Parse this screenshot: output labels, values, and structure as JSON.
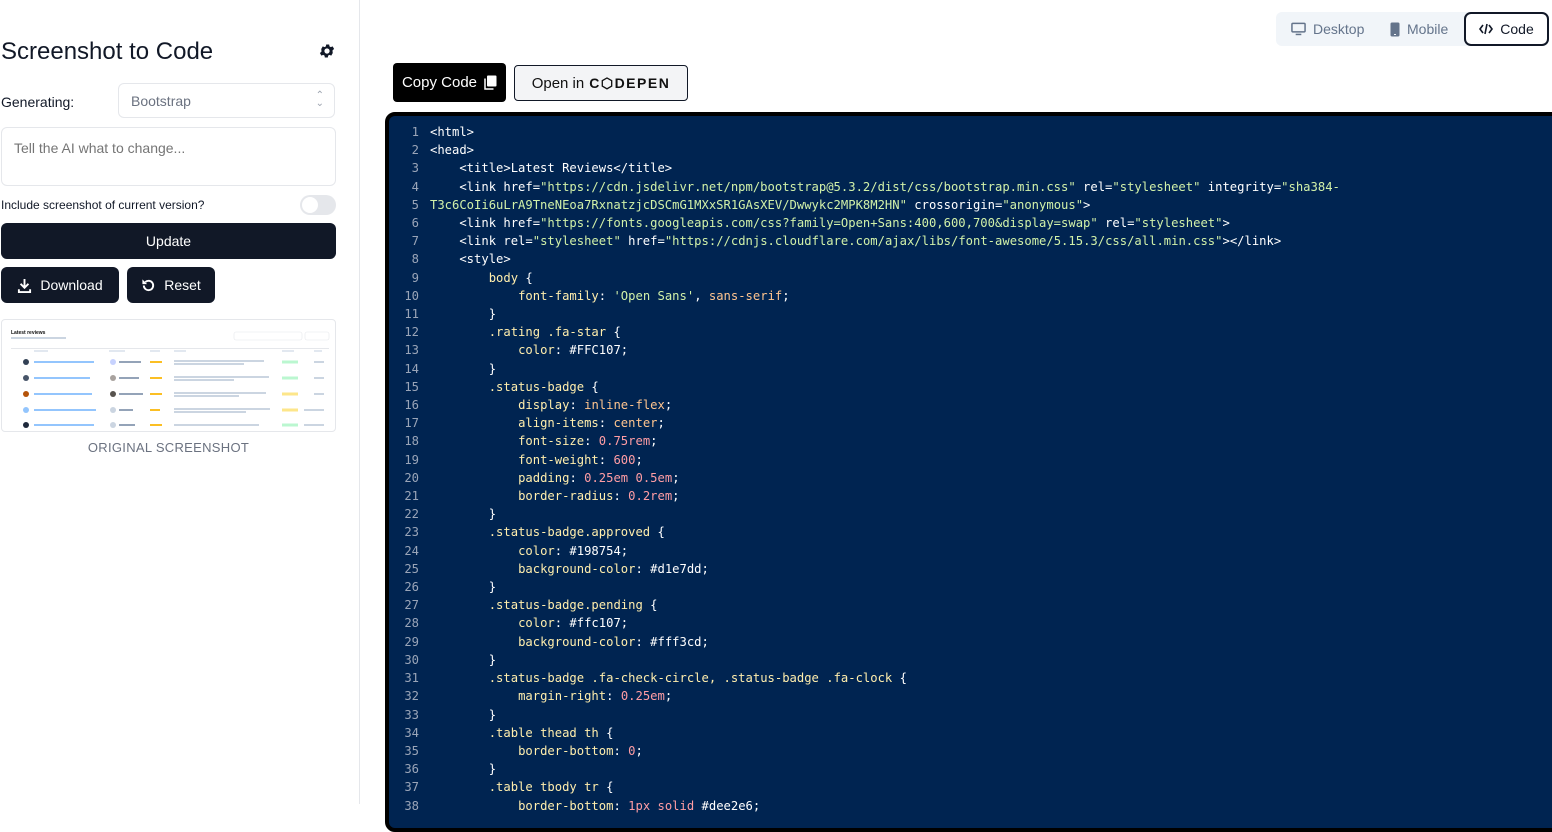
{
  "sidebar": {
    "title": "Screenshot to Code",
    "generating_label": "Generating:",
    "framework_value": "Bootstrap",
    "instruction_placeholder": "Tell the AI what to change...",
    "include_screenshot_label": "Include screenshot of current version?",
    "update_label": "Update",
    "download_label": "Download",
    "reset_label": "Reset",
    "thumbnail_caption": "ORIGINAL SCREENSHOT",
    "thumbnail_title": "Latest reviews"
  },
  "view_tabs": {
    "desktop": "Desktop",
    "mobile": "Mobile",
    "code": "Code",
    "active": "code"
  },
  "toolbar": {
    "copy_code_label": "Copy Code",
    "open_in_label": "Open in",
    "codepen_label": "C⬡DEPEN"
  },
  "code_lines": [
    [
      {
        "t": "<html>",
        "c": "c-tag"
      }
    ],
    [
      {
        "t": "<head>",
        "c": "c-tag"
      }
    ],
    [
      {
        "t": "    <title>Latest Reviews</title>",
        "c": "c-tag"
      }
    ],
    [
      {
        "t": "    <link href=",
        "c": "c-tag"
      },
      {
        "t": "\"https://cdn.jsdelivr.net/npm/bootstrap@5.3.2/dist/css/bootstrap.min.css\"",
        "c": "c-str"
      },
      {
        "t": " rel=",
        "c": "c-tag"
      },
      {
        "t": "\"stylesheet\"",
        "c": "c-str"
      },
      {
        "t": " integrity=",
        "c": "c-tag"
      },
      {
        "t": "\"sha384-",
        "c": "c-str"
      }
    ],
    [
      {
        "t": "T3c6CoIi6uLrA9TneNEoa7RxnatzjcDSCmG1MXxSR1GAsXEV/Dwwykc2MPK8M2HN\"",
        "c": "c-str"
      },
      {
        "t": " crossorigin=",
        "c": "c-tag"
      },
      {
        "t": "\"anonymous\"",
        "c": "c-str"
      },
      {
        "t": ">",
        "c": "c-tag"
      }
    ],
    [
      {
        "t": "    <link href=",
        "c": "c-tag"
      },
      {
        "t": "\"https://fonts.googleapis.com/css?family=Open+Sans:400,600,700&display=swap\"",
        "c": "c-str"
      },
      {
        "t": " rel=",
        "c": "c-tag"
      },
      {
        "t": "\"stylesheet\"",
        "c": "c-str"
      },
      {
        "t": ">",
        "c": "c-tag"
      }
    ],
    [
      {
        "t": "    <link rel=",
        "c": "c-tag"
      },
      {
        "t": "\"stylesheet\"",
        "c": "c-str"
      },
      {
        "t": " href=",
        "c": "c-tag"
      },
      {
        "t": "\"https://cdnjs.cloudflare.com/ajax/libs/font-awesome/5.15.3/css/all.min.css\"",
        "c": "c-str"
      },
      {
        "t": "></link>",
        "c": "c-tag"
      }
    ],
    [
      {
        "t": "    <style>",
        "c": "c-tag"
      }
    ],
    [
      {
        "t": "        ",
        "c": "txt"
      },
      {
        "t": "body",
        "c": "c-sel"
      },
      {
        "t": " {",
        "c": "txt"
      }
    ],
    [
      {
        "t": "            ",
        "c": "txt"
      },
      {
        "t": "font-family",
        "c": "c-prop"
      },
      {
        "t": ": ",
        "c": "txt"
      },
      {
        "t": "'Open Sans'",
        "c": "c-str"
      },
      {
        "t": ", ",
        "c": "txt"
      },
      {
        "t": "sans-serif",
        "c": "c-kw"
      },
      {
        "t": ";",
        "c": "txt"
      }
    ],
    [
      {
        "t": "        }",
        "c": "txt"
      }
    ],
    [
      {
        "t": "        ",
        "c": "txt"
      },
      {
        "t": ".rating .fa-star",
        "c": "c-sel"
      },
      {
        "t": " {",
        "c": "txt"
      }
    ],
    [
      {
        "t": "            ",
        "c": "txt"
      },
      {
        "t": "color",
        "c": "c-prop"
      },
      {
        "t": ": #FFC107;",
        "c": "txt"
      }
    ],
    [
      {
        "t": "        }",
        "c": "txt"
      }
    ],
    [
      {
        "t": "        ",
        "c": "txt"
      },
      {
        "t": ".status-badge",
        "c": "c-sel"
      },
      {
        "t": " {",
        "c": "txt"
      }
    ],
    [
      {
        "t": "            ",
        "c": "txt"
      },
      {
        "t": "display",
        "c": "c-prop"
      },
      {
        "t": ": ",
        "c": "txt"
      },
      {
        "t": "inline-flex",
        "c": "c-kw"
      },
      {
        "t": ";",
        "c": "txt"
      }
    ],
    [
      {
        "t": "            ",
        "c": "txt"
      },
      {
        "t": "align-items",
        "c": "c-prop"
      },
      {
        "t": ": ",
        "c": "txt"
      },
      {
        "t": "center",
        "c": "c-kw"
      },
      {
        "t": ";",
        "c": "txt"
      }
    ],
    [
      {
        "t": "            ",
        "c": "txt"
      },
      {
        "t": "font-size",
        "c": "c-prop"
      },
      {
        "t": ": ",
        "c": "txt"
      },
      {
        "t": "0.75rem",
        "c": "c-num"
      },
      {
        "t": ";",
        "c": "txt"
      }
    ],
    [
      {
        "t": "            ",
        "c": "txt"
      },
      {
        "t": "font-weight",
        "c": "c-prop"
      },
      {
        "t": ": ",
        "c": "txt"
      },
      {
        "t": "600",
        "c": "c-num"
      },
      {
        "t": ";",
        "c": "txt"
      }
    ],
    [
      {
        "t": "            ",
        "c": "txt"
      },
      {
        "t": "padding",
        "c": "c-prop"
      },
      {
        "t": ": ",
        "c": "txt"
      },
      {
        "t": "0.25em 0.5em",
        "c": "c-num"
      },
      {
        "t": ";",
        "c": "txt"
      }
    ],
    [
      {
        "t": "            ",
        "c": "txt"
      },
      {
        "t": "border-radius",
        "c": "c-prop"
      },
      {
        "t": ": ",
        "c": "txt"
      },
      {
        "t": "0.2rem",
        "c": "c-num"
      },
      {
        "t": ";",
        "c": "txt"
      }
    ],
    [
      {
        "t": "        }",
        "c": "txt"
      }
    ],
    [
      {
        "t": "        ",
        "c": "txt"
      },
      {
        "t": ".status-badge.approved",
        "c": "c-sel"
      },
      {
        "t": " {",
        "c": "txt"
      }
    ],
    [
      {
        "t": "            ",
        "c": "txt"
      },
      {
        "t": "color",
        "c": "c-prop"
      },
      {
        "t": ": #198754;",
        "c": "txt"
      }
    ],
    [
      {
        "t": "            ",
        "c": "txt"
      },
      {
        "t": "background-color",
        "c": "c-prop"
      },
      {
        "t": ": #d1e7dd;",
        "c": "txt"
      }
    ],
    [
      {
        "t": "        }",
        "c": "txt"
      }
    ],
    [
      {
        "t": "        ",
        "c": "txt"
      },
      {
        "t": ".status-badge.pending",
        "c": "c-sel"
      },
      {
        "t": " {",
        "c": "txt"
      }
    ],
    [
      {
        "t": "            ",
        "c": "txt"
      },
      {
        "t": "color",
        "c": "c-prop"
      },
      {
        "t": ": #ffc107;",
        "c": "txt"
      }
    ],
    [
      {
        "t": "            ",
        "c": "txt"
      },
      {
        "t": "background-color",
        "c": "c-prop"
      },
      {
        "t": ": #fff3cd;",
        "c": "txt"
      }
    ],
    [
      {
        "t": "        }",
        "c": "txt"
      }
    ],
    [
      {
        "t": "        ",
        "c": "txt"
      },
      {
        "t": ".status-badge .fa-check-circle, .status-badge .fa-clock",
        "c": "c-sel"
      },
      {
        "t": " {",
        "c": "txt"
      }
    ],
    [
      {
        "t": "            ",
        "c": "txt"
      },
      {
        "t": "margin-right",
        "c": "c-prop"
      },
      {
        "t": ": ",
        "c": "txt"
      },
      {
        "t": "0.25em",
        "c": "c-num"
      },
      {
        "t": ";",
        "c": "txt"
      }
    ],
    [
      {
        "t": "        }",
        "c": "txt"
      }
    ],
    [
      {
        "t": "        ",
        "c": "txt"
      },
      {
        "t": ".table thead th",
        "c": "c-sel"
      },
      {
        "t": " {",
        "c": "txt"
      }
    ],
    [
      {
        "t": "            ",
        "c": "txt"
      },
      {
        "t": "border-bottom",
        "c": "c-prop"
      },
      {
        "t": ": ",
        "c": "txt"
      },
      {
        "t": "0",
        "c": "c-num"
      },
      {
        "t": ";",
        "c": "txt"
      }
    ],
    [
      {
        "t": "        }",
        "c": "txt"
      }
    ],
    [
      {
        "t": "        ",
        "c": "txt"
      },
      {
        "t": ".table tbody tr",
        "c": "c-sel"
      },
      {
        "t": " {",
        "c": "txt"
      }
    ],
    [
      {
        "t": "            ",
        "c": "txt"
      },
      {
        "t": "border-bottom",
        "c": "c-prop"
      },
      {
        "t": ": ",
        "c": "txt"
      },
      {
        "t": "1px solid",
        "c": "c-num"
      },
      {
        "t": " #dee2e6;",
        "c": "txt"
      }
    ]
  ],
  "colors": {
    "editor_bg": "#002451",
    "primary_dark": "#111827",
    "muted_text": "#6b7280"
  }
}
